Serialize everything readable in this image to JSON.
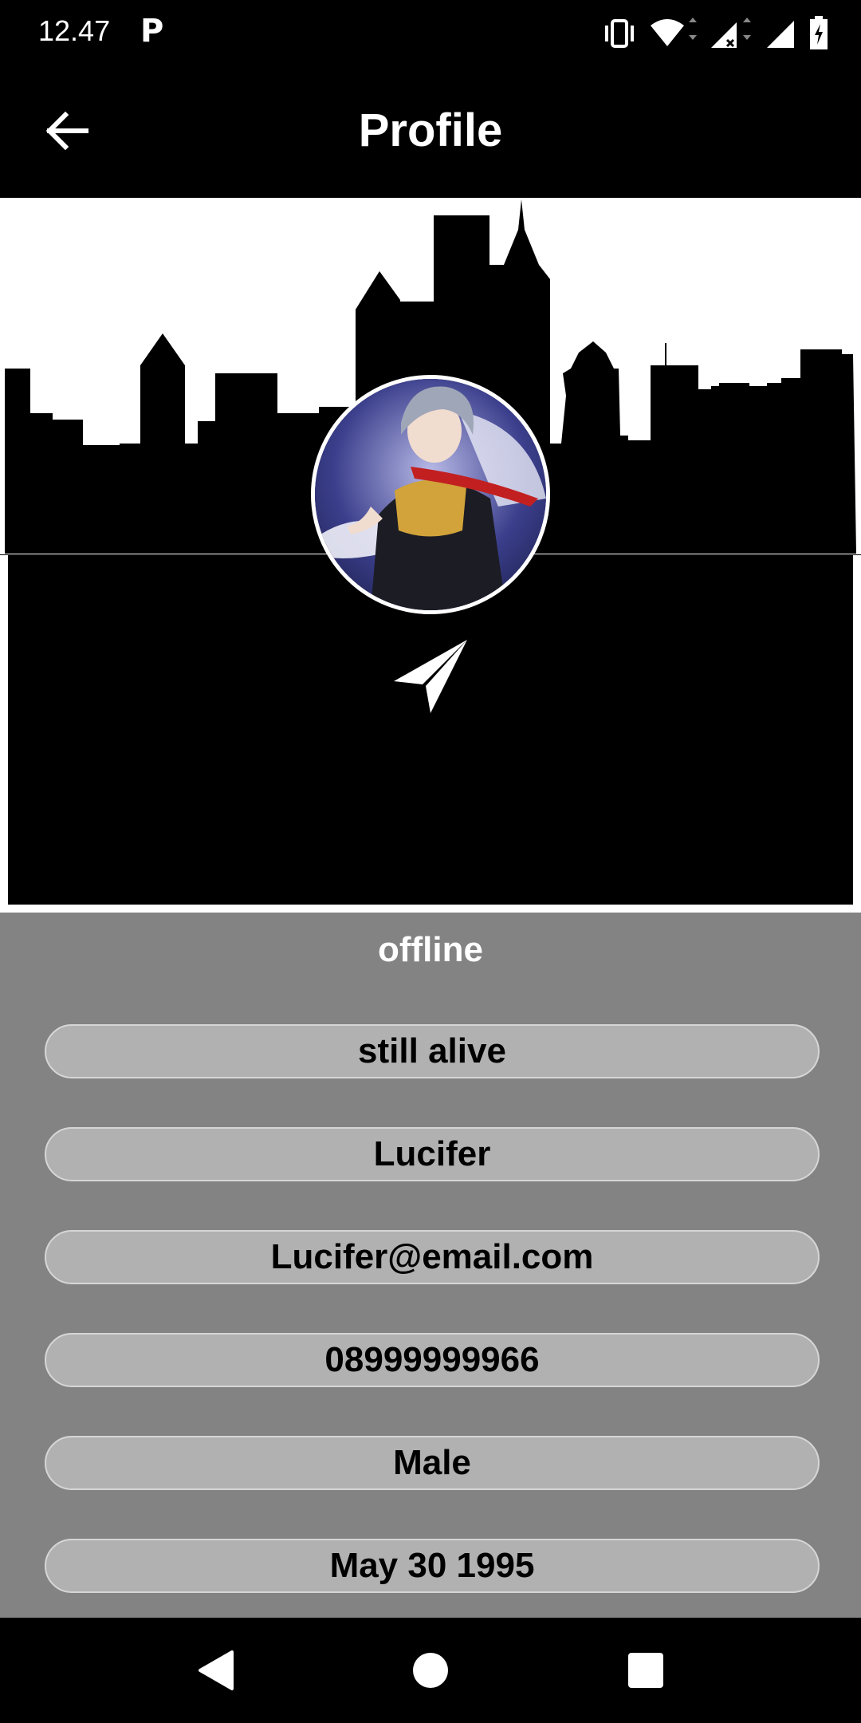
{
  "status_bar": {
    "time": "12.47",
    "app_indicator": "P",
    "icons": [
      "vibrate-icon",
      "wifi-icon",
      "signal-x-icon",
      "signal-icon",
      "battery-charging-icon"
    ]
  },
  "app_bar": {
    "title": "Profile",
    "back_icon": "arrow-left-icon"
  },
  "header": {
    "background_image": "city-skyline",
    "avatar": "profile-avatar",
    "action_icon": "send-icon"
  },
  "profile": {
    "presence": "offline",
    "bio": "still alive",
    "name": "Lucifer",
    "email": "Lucifer@email.com",
    "phone": "08999999966",
    "gender": "Male",
    "birthday": "May 30 1995"
  },
  "nav_bar": {
    "icons": [
      "back-triangle-icon",
      "home-circle-icon",
      "recents-square-icon"
    ]
  },
  "colors": {
    "background": "#000000",
    "info_background": "#838383",
    "pill_background": "#b1b1b1",
    "text_light": "#ffffff"
  }
}
